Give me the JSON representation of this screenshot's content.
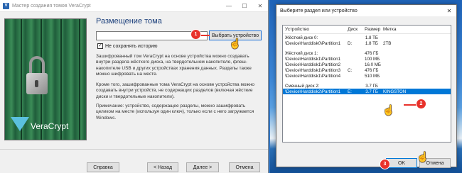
{
  "wizard": {
    "title": "Мастер создания томов VeraCrypt",
    "window_controls": {
      "minimize": "—",
      "maximize": "☐",
      "close": "✕"
    },
    "heading": "Размещение тома",
    "path_value": "",
    "select_device_label": "Выбрать устройство",
    "no_history_label": "Не сохранять историю",
    "no_history_checked": "✓",
    "paragraph1": "Зашифрованный том VeraCrypt на основе устройства можно создавать внутри раздела жёсткого диска, на твердотельном накопителе, флеш-накопителе USB и других устройствах хранения данных. Разделы также можно шифровать на месте.",
    "paragraph2": "Кроме того, зашифрованные тома VeraCrypt на основе устройства можно создавать внутри устройств, не содержащих разделов (включая жёсткие диски и твердотельные накопители).",
    "paragraph3": "Примечание: устройство, содержащее разделы, можно зашифровать целиком на месте (используя один ключ), только если с него загружается Windows.",
    "logo_text": "VeraCrypt",
    "buttons": {
      "help": "Справка",
      "back": "< Назад",
      "next": "Далее >",
      "cancel": "Отмена"
    }
  },
  "dialog": {
    "title": "Выберите раздел или устройство",
    "close": "✕",
    "columns": {
      "device": "Устройство",
      "drive": "Диск",
      "size": "Размер",
      "label": "Метка"
    },
    "rows": [
      {
        "device": "Жёсткий диск 0:",
        "drive": "",
        "size": "1.8 ТБ",
        "label": ""
      },
      {
        "device": "\\Device\\Harddisk0\\Partition1",
        "drive": "D:",
        "size": "1.8 ТБ",
        "label": "2ТВ"
      },
      {
        "spacer": true
      },
      {
        "device": "Жёсткий диск 1:",
        "drive": "",
        "size": "476 ГБ",
        "label": ""
      },
      {
        "device": "\\Device\\Harddisk1\\Partition1",
        "drive": "",
        "size": "100 МБ",
        "label": ""
      },
      {
        "device": "\\Device\\Harddisk1\\Partition2",
        "drive": "",
        "size": "16.0 МБ",
        "label": ""
      },
      {
        "device": "\\Device\\Harddisk1\\Partition3",
        "drive": "C:",
        "size": "476 ГБ",
        "label": ""
      },
      {
        "device": "\\Device\\Harddisk1\\Partition4",
        "drive": "",
        "size": "510 МБ",
        "label": ""
      },
      {
        "spacer": true
      },
      {
        "device": "Сменный диск 2:",
        "drive": "",
        "size": "3.7 ГБ",
        "label": ""
      },
      {
        "device": "\\Device\\Harddisk2\\Partition1",
        "drive": "E:",
        "size": "3.7 ГБ",
        "label": "KINGSTON",
        "selected": true
      }
    ],
    "ok_label": "OK",
    "cancel_label": "Отмена"
  },
  "annotations": {
    "step1": "1",
    "step2": "2",
    "step3": "3"
  },
  "colors": {
    "accent": "#0078d7",
    "badge": "#e8322b",
    "heading": "#1a3e7a"
  }
}
